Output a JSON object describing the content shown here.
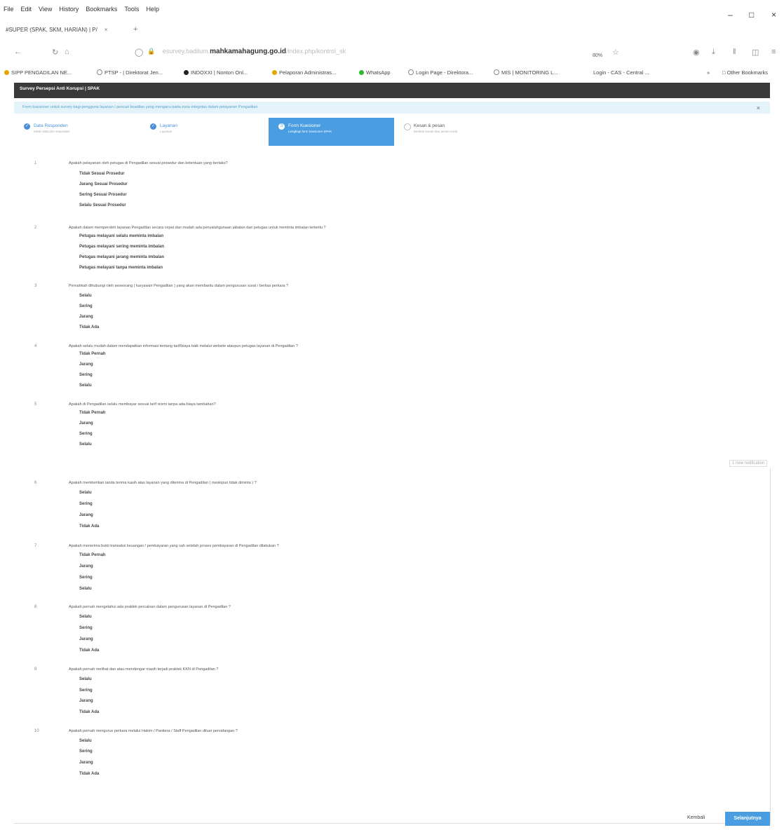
{
  "browser": {
    "menus": [
      "File",
      "Edit",
      "View",
      "History",
      "Bookmarks",
      "Tools",
      "Help"
    ],
    "tab_title": "#SUPER (SPAK, SKM, HARIAN) | P/",
    "url_domain": "mahkamahagung.go.id",
    "zoom": "80%",
    "bookmarks": [
      "SIPP PENGADILAN NE...",
      "PTSP - | Direktorat Jen...",
      "INDOXXI | Nonton Onl...",
      "Pelaporan Administras...",
      "WhatsApp",
      "Login Page - Direktora...",
      "MIS | MONITORING L...",
      "Login - CAS - Central ...",
      "Other Bookmarks"
    ]
  },
  "page": {
    "header_title": "Survey Persepsi Anti Korupsi | SPAK",
    "notice": "Form kuesioner untuk survey bagi pengguna layanan / pencari keadilan yang mengacu pada zona integritas dalam pelayanan Pengadilan",
    "steps": [
      {
        "title": "Data Responden",
        "sub": "Isikan data diri responden",
        "state": "done"
      },
      {
        "title": "Layanan",
        "sub": "Layanan",
        "state": "done"
      },
      {
        "title": "Form Kuesioner",
        "sub": "Lengkapi form kuesioner SPAK",
        "state": "active",
        "num": "3"
      },
      {
        "title": "Kesan & pesan",
        "sub": "Berikan kesan dan pesan Anda",
        "state": "todo"
      }
    ],
    "questions": [
      {
        "num": "1",
        "text": "Apakah pelayanan oleh petugas di Pengadilan sesuai prosedur dan ketentuan yang berlaku?",
        "options": [
          "Tidak Sesuai Prosedur",
          "Jarang Sesuai Prosedur",
          "Sering Sesuai Prosedur",
          "Selalu Sesuai Prosedur"
        ]
      },
      {
        "num": "2",
        "text": "Apakah dalam memperoleh layanan Pengadilan secara cepat dan mudah ada penyalahgunaan jabatan dari petugas untuk meminta imbalan tertentu ?",
        "options": [
          "Petugas melayani selalu meminta imbalan",
          "Petugas melayani sering meminta imbalan",
          "Petugas melayani jarang meminta imbalan",
          "Petugas melayani tanpa meminta imbalan"
        ]
      },
      {
        "num": "3",
        "text": "Pernahkah dihubungi oleh seseorang ( karyawan Pengadilan ) yang akan membantu dalam pengurusan surat / berkas perkara ?",
        "options": [
          "Selalu",
          "Sering",
          "Jarang",
          "Tidak Ada"
        ]
      },
      {
        "num": "4",
        "text": "Apakah selalu mudah dalam mendapatkan informasi tentang tarif/biaya baik melalui website ataupun petugas layanan di Pengadilan ?",
        "options": [
          "Tidak Pernah",
          "Jarang",
          "Sering",
          "Selalu"
        ]
      },
      {
        "num": "5",
        "text": "Apakah di Pengadilan selalu membayar sesuai tarif resmi tanpa ada biaya tambahan?",
        "options": [
          "Tidak Pernah",
          "Jarang",
          "Sering",
          "Selalu"
        ]
      },
      {
        "num": "6",
        "text": "Apakah memberikan tanda terima kasih atas layanan yang diterima di Pengadilan ( meskipun tidak diminta ) ?",
        "options": [
          "Selalu",
          "Sering",
          "Jarang",
          "Tidak Ada"
        ]
      },
      {
        "num": "7",
        "text": "Apakah menerima bukti transaksi keuangan / pembayaran yang sah setelah proses pembayaran di Pengadilan dilakukan ?",
        "options": [
          "Tidak Pernah",
          "Jarang",
          "Sering",
          "Selalu"
        ]
      },
      {
        "num": "8",
        "text": "Apakah pernah mengetahui ada praktek percaloan dalam pengurusan layanan di Pengadilan ?",
        "options": [
          "Selalu",
          "Sering",
          "Jarang",
          "Tidak Ada"
        ]
      },
      {
        "num": "9",
        "text": "Apakah pernah melihat dan atau mendengar masih terjadi praktek KKN di Pengadilan ?",
        "options": [
          "Selalu",
          "Sering",
          "Jarang",
          "Tidak Ada"
        ]
      },
      {
        "num": "10",
        "text": "Apakah pernah mengurus perkara melalui Hakim / Panitera / Staff Pengadilan diluar persidangan ?",
        "options": [
          "Selalu",
          "Sering",
          "Jarang",
          "Tidak Ada"
        ]
      }
    ],
    "notif_label": "1 new notification",
    "back_label": "Kembali",
    "next_label": "Selanjutnya"
  }
}
